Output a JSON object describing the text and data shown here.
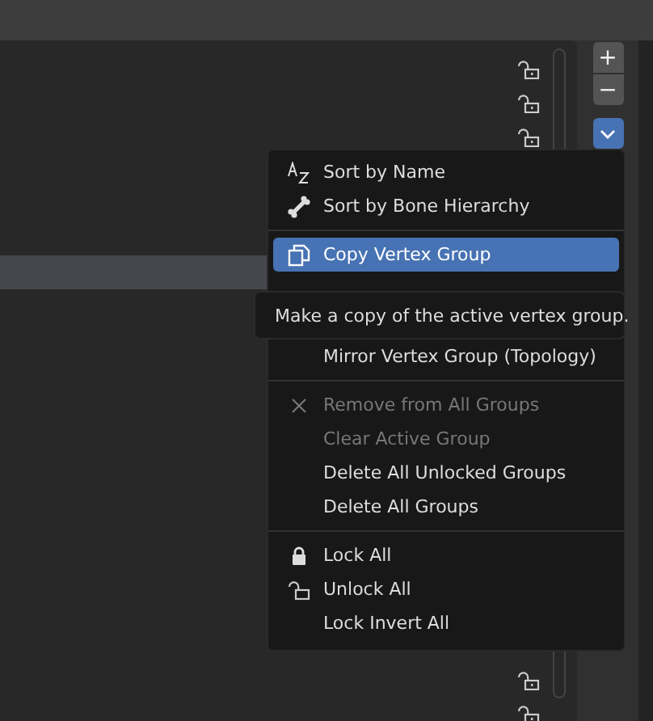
{
  "list": {
    "rows": [
      {
        "selected": false,
        "locked": false
      },
      {
        "selected": false,
        "locked": false
      },
      {
        "selected": false,
        "locked": false
      },
      {
        "selected": false
      },
      {
        "selected": false
      },
      {
        "selected": false
      },
      {
        "selected": true
      },
      {
        "selected": false
      },
      {
        "selected": false
      },
      {
        "selected": false
      },
      {
        "selected": false
      },
      {
        "selected": false
      },
      {
        "selected": false
      },
      {
        "selected": false
      },
      {
        "selected": false
      },
      {
        "selected": false
      },
      {
        "selected": false
      },
      {
        "selected": false
      },
      {
        "selected": false,
        "locked": false
      },
      {
        "selected": false,
        "locked": false
      }
    ]
  },
  "side_buttons": {
    "add": "+",
    "remove": "−",
    "specials_open": true
  },
  "menu": {
    "items": [
      {
        "kind": "item",
        "label": "Sort by Name",
        "selected": false,
        "disabled": false
      },
      {
        "kind": "item",
        "label": "Sort by Bone Hierarchy",
        "selected": false,
        "disabled": false
      },
      {
        "kind": "separator"
      },
      {
        "kind": "item",
        "label": "Copy Vertex Group",
        "selected": true,
        "disabled": false
      },
      {
        "kind": "item",
        "label": "Mirror Vertex Group (Topology)",
        "selected": false,
        "disabled": false
      },
      {
        "kind": "separator"
      },
      {
        "kind": "item",
        "label": "Remove from All Groups",
        "selected": false,
        "disabled": true
      },
      {
        "kind": "item",
        "label": "Clear Active Group",
        "selected": false,
        "disabled": true
      },
      {
        "kind": "item",
        "label": "Delete All Unlocked Groups",
        "selected": false,
        "disabled": false
      },
      {
        "kind": "item",
        "label": "Delete All Groups",
        "selected": false,
        "disabled": false
      },
      {
        "kind": "separator"
      },
      {
        "kind": "item",
        "label": "Lock All",
        "selected": false,
        "disabled": false
      },
      {
        "kind": "item",
        "label": "Unlock All",
        "selected": false,
        "disabled": false
      },
      {
        "kind": "item",
        "label": "Lock Invert All",
        "selected": false,
        "disabled": false
      }
    ]
  },
  "tooltip": {
    "text": "Make a copy of the active vertex group."
  }
}
